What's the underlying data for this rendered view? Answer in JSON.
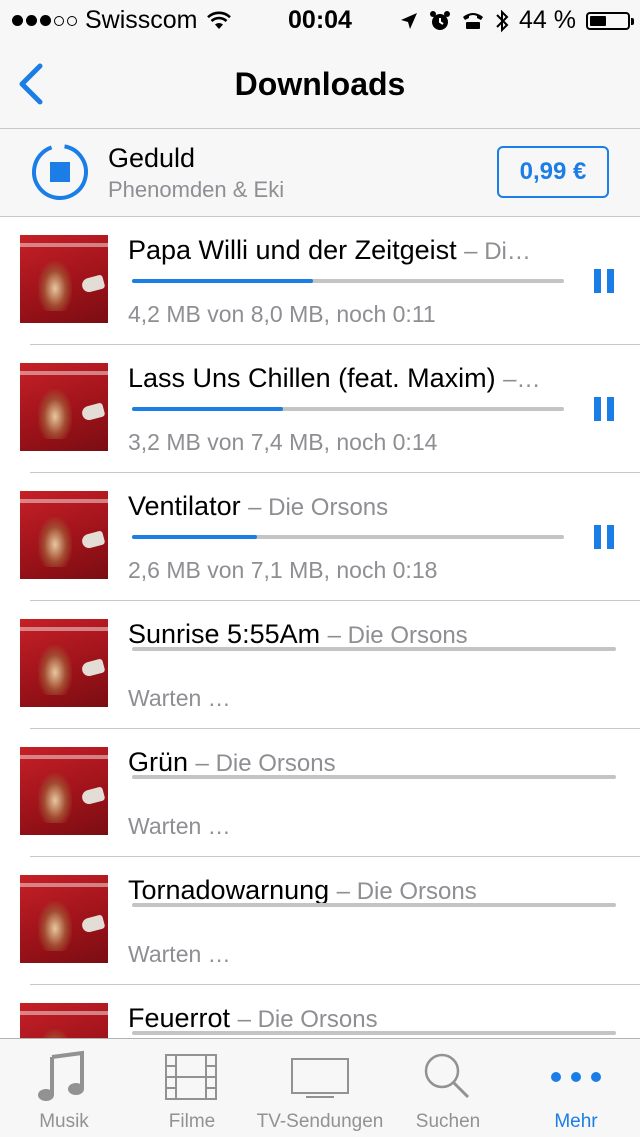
{
  "status_bar": {
    "carrier": "Swisscom",
    "time": "00:04",
    "battery": "44 %",
    "battery_level": 0.44
  },
  "nav": {
    "title": "Downloads"
  },
  "current": {
    "title": "Geduld",
    "artist": "Phenomden & Eki",
    "price": "0,99 €"
  },
  "downloads": [
    {
      "title": "Papa Willi und der Zeitgeist",
      "artist": "– Di…",
      "status": "4,2 MB von 8,0 MB, noch 0:11",
      "progress": 0.42,
      "paused_control": true
    },
    {
      "title": "Lass Uns Chillen (feat. Maxim)",
      "artist": "–…",
      "status": "3,2 MB von 7,4 MB, noch 0:14",
      "progress": 0.35,
      "paused_control": true
    },
    {
      "title": "Ventilator",
      "artist": "– Die Orsons",
      "status": "2,6 MB von 7,1 MB, noch 0:18",
      "progress": 0.29,
      "paused_control": true
    },
    {
      "title": "Sunrise 5:55Am",
      "artist": "– Die Orsons",
      "status": "Warten …",
      "progress": 0,
      "paused_control": false
    },
    {
      "title": "Grün",
      "artist": "– Die Orsons",
      "status": "Warten …",
      "progress": 0,
      "paused_control": false
    },
    {
      "title": "Tornadowarnung",
      "artist": "– Die Orsons",
      "status": "Warten …",
      "progress": 0,
      "paused_control": false
    },
    {
      "title": "Feuerrot",
      "artist": "– Die Orsons",
      "status": "",
      "progress": 0,
      "paused_control": false
    }
  ],
  "tabs": [
    {
      "label": "Musik",
      "icon": "music-note-icon",
      "active": false
    },
    {
      "label": "Filme",
      "icon": "film-strip-icon",
      "active": false
    },
    {
      "label": "TV-Sendungen",
      "icon": "tv-icon",
      "active": false
    },
    {
      "label": "Suchen",
      "icon": "search-icon",
      "active": false
    },
    {
      "label": "Mehr",
      "icon": "more-icon",
      "active": true
    }
  ],
  "colors": {
    "accent": "#1a7ee6",
    "secondary_text": "#8e8e93",
    "bar_background": "#f7f7f8"
  }
}
